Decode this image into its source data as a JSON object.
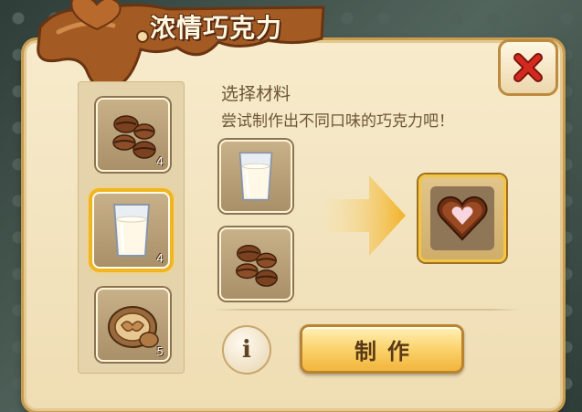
{
  "window": {
    "title": "浓情巧克力",
    "close_icon": "close-icon"
  },
  "materials": [
    {
      "icon": "coffee-beans-icon",
      "count": "4",
      "selected": false
    },
    {
      "icon": "milk-glass-icon",
      "count": "4",
      "selected": true
    },
    {
      "icon": "walnut-icon",
      "count": "5",
      "selected": false
    }
  ],
  "crafting": {
    "heading": "选择材料",
    "hint": "尝试制作出不同口味的巧克力吧！",
    "inputs": [
      {
        "icon": "milk-glass-icon"
      },
      {
        "icon": "coffee-beans-icon"
      }
    ],
    "arrow_icon": "arrow-right-icon",
    "result_icon": "heart-chocolate-icon"
  },
  "actions": {
    "info_label": "i",
    "make_label": "制作"
  },
  "colors": {
    "panel": "#f7ebcc",
    "accent": "#f0b521",
    "close_red": "#d42a1e",
    "text_brown": "#6d5537"
  }
}
